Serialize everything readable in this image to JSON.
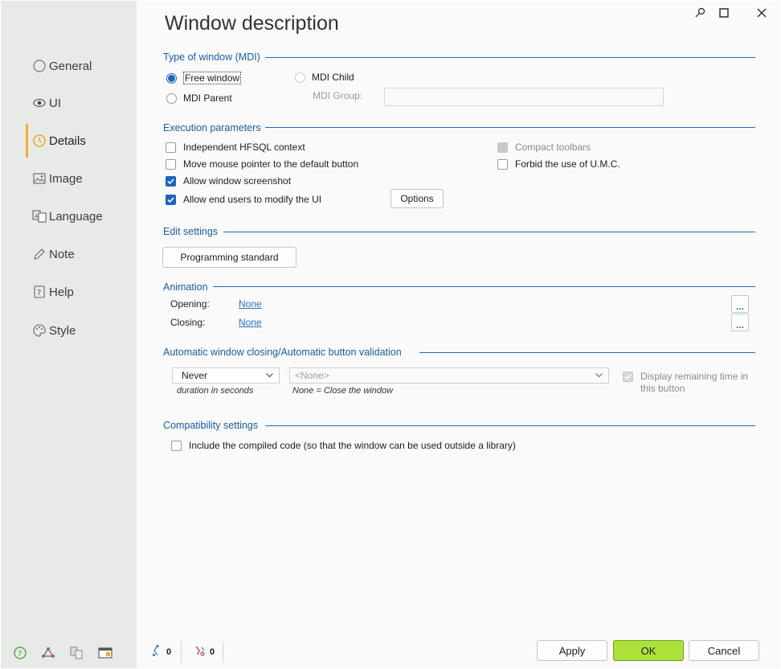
{
  "window": {
    "title": "Window description"
  },
  "sidebar": {
    "items": [
      {
        "label": "General",
        "icon": "circle-icon"
      },
      {
        "label": "UI",
        "icon": "eye-icon"
      },
      {
        "label": "Details",
        "icon": "clock-icon",
        "active": true
      },
      {
        "label": "Image",
        "icon": "image-icon"
      },
      {
        "label": "Language",
        "icon": "language-icon"
      },
      {
        "label": "Note",
        "icon": "pencil-icon"
      },
      {
        "label": "Help",
        "icon": "help-book-icon"
      },
      {
        "label": "Style",
        "icon": "palette-icon"
      }
    ],
    "accent_color": "#f0b030"
  },
  "type_of_window": {
    "title": "Type of window (MDI)",
    "free_window": "Free window",
    "mdi_child": "MDI Child",
    "mdi_parent": "MDI Parent",
    "mdi_group_label": "MDI Group:",
    "mdi_group_value": "",
    "selected": "Free window"
  },
  "execution": {
    "title": "Execution parameters",
    "independent_hfsql": "Independent HFSQL context",
    "move_mouse": "Move mouse pointer to the default button",
    "allow_screenshot": "Allow window screenshot",
    "allow_modify_ui": "Allow end users to modify the UI",
    "compact_toolbars": "Compact toolbars",
    "forbid_umc": "Forbid the use of U.M.C.",
    "options_button": "Options"
  },
  "edit_settings": {
    "title": "Edit settings",
    "programming_standard_button": "Programming standard"
  },
  "animation": {
    "title": "Animation",
    "opening_label": "Opening:",
    "opening_value": "None",
    "closing_label": "Closing:",
    "closing_value": "None",
    "dots": "..."
  },
  "auto_close": {
    "title": "Automatic window closing/Automatic button validation",
    "duration_value": "Never",
    "duration_hint": "duration in seconds",
    "button_value": "<None>",
    "button_hint": "None = Close the window",
    "display_remaining_line1": "Display remaining time in",
    "display_remaining_line2": "this button"
  },
  "compatibility": {
    "title": "Compatibility settings",
    "include_compiled": "Include the compiled code (so that the window can be used outside a library)"
  },
  "footer": {
    "link_count": "0",
    "broken_count": "0",
    "apply": "Apply",
    "ok": "OK",
    "cancel": "Cancel"
  },
  "colors": {
    "section_title": "#1a5fa0",
    "link": "#2a74c8",
    "check_on": "#1e64b8",
    "ok_button": "#aee03c"
  }
}
